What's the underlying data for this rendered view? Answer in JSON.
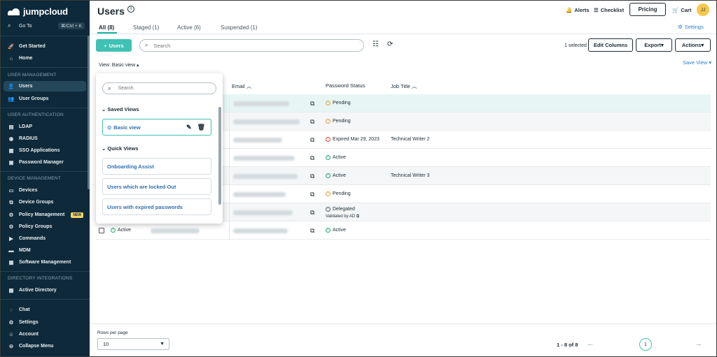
{
  "brand": {
    "name": "jumpcloud"
  },
  "sidebar": {
    "goto": {
      "label": "Go To",
      "shortcut": "⌘/Ctrl + K"
    },
    "top_items": [
      {
        "label": "Get Started",
        "icon": "rocket-icon"
      },
      {
        "label": "Home",
        "icon": "home-icon"
      }
    ],
    "sections": {
      "user_management": "USER MANAGEMENT",
      "user_authentication": "USER AUTHENTICATION",
      "device_management": "DEVICE MANAGEMENT",
      "directory_integrations": "DIRECTORY INTEGRATIONS"
    },
    "user_management_items": [
      {
        "label": "Users",
        "icon": "user-icon",
        "active": true
      },
      {
        "label": "User Groups",
        "icon": "user-groups-icon"
      }
    ],
    "user_authentication_items": [
      {
        "label": "LDAP",
        "icon": "ldap-icon"
      },
      {
        "label": "RADIUS",
        "icon": "radius-icon"
      },
      {
        "label": "SSO Applications",
        "icon": "apps-icon"
      },
      {
        "label": "Password Manager",
        "icon": "password-icon"
      }
    ],
    "device_management_items": [
      {
        "label": "Devices",
        "icon": "devices-icon"
      },
      {
        "label": "Device Groups",
        "icon": "device-groups-icon"
      },
      {
        "label": "Policy Management",
        "icon": "policy-icon",
        "badge": "NEW"
      },
      {
        "label": "Policy Groups",
        "icon": "policy-groups-icon"
      },
      {
        "label": "Commands",
        "icon": "commands-icon"
      },
      {
        "label": "MDM",
        "icon": "mdm-icon"
      },
      {
        "label": "Software Management",
        "icon": "software-icon"
      }
    ],
    "directory_items": [
      {
        "label": "Active Directory",
        "icon": "active-directory-icon"
      }
    ],
    "bottom_items": [
      {
        "label": "Chat",
        "icon": "chat-icon"
      },
      {
        "label": "Settings",
        "icon": "gear-icon"
      },
      {
        "label": "Account",
        "icon": "account-icon"
      },
      {
        "label": "Collapse Menu",
        "icon": "collapse-icon"
      }
    ]
  },
  "header": {
    "title": "Users",
    "alerts": "Alerts",
    "checklist": "Checklist",
    "pricing": "Pricing",
    "cart": "Cart",
    "avatar_initials": "JJ"
  },
  "tabs": [
    {
      "label": "All (8)",
      "active": true
    },
    {
      "label": "Staged (1)"
    },
    {
      "label": "Active (6)"
    },
    {
      "label": "Suspended (1)"
    }
  ],
  "settings_link": "Settings",
  "toolbar": {
    "add_users": "Users",
    "search_placeholder": "Search",
    "selected_count": "1 selected",
    "edit_columns": "Edit Columns",
    "export": "Export",
    "actions": "Actions"
  },
  "view": {
    "label": "View: Basic view",
    "save_view": "Save View"
  },
  "table": {
    "columns": {
      "email": "Email",
      "password_status": "Password Status",
      "job_title": "Job Title"
    },
    "rows": [
      {
        "password_status": "Pending",
        "status_kind": "pending",
        "job_title": ""
      },
      {
        "password_status": "Pending",
        "status_kind": "pending",
        "job_title": ""
      },
      {
        "password_status": "Expired Mar 29, 2023",
        "status_kind": "expired",
        "job_title": "Technical Writer 2"
      },
      {
        "password_status": "Active",
        "status_kind": "active",
        "job_title": ""
      },
      {
        "password_status": "Active",
        "status_kind": "active",
        "job_title": "Technical Writer 3"
      },
      {
        "password_status": "Pending",
        "status_kind": "pending",
        "job_title": ""
      },
      {
        "password_status": "Delegated",
        "status_kind": "delegated",
        "sub": "Validated by AD",
        "job_title": ""
      },
      {
        "password_status": "Active",
        "status_kind": "active",
        "job_title": "",
        "user_state": "Active"
      }
    ]
  },
  "views_panel": {
    "search_placeholder": "Search",
    "saved_views_title": "Saved Views",
    "saved_views": [
      "Basic view"
    ],
    "quick_views_title": "Quick Views",
    "quick_views": [
      "Onboarding Assist",
      "Users which are locked Out",
      "Users with expired passwords"
    ]
  },
  "footer": {
    "rows_per_page_label": "Rows per page",
    "rows_per_page_value": "10",
    "range": "1 - 8 of 8",
    "current_page": "1"
  },
  "colors": {
    "sidebar_bg": "#0e2a3a",
    "accent": "#3fc1b4",
    "link": "#2f7fc9",
    "pending": "#e8a23a",
    "expired": "#d9453b",
    "active": "#2aa876"
  }
}
